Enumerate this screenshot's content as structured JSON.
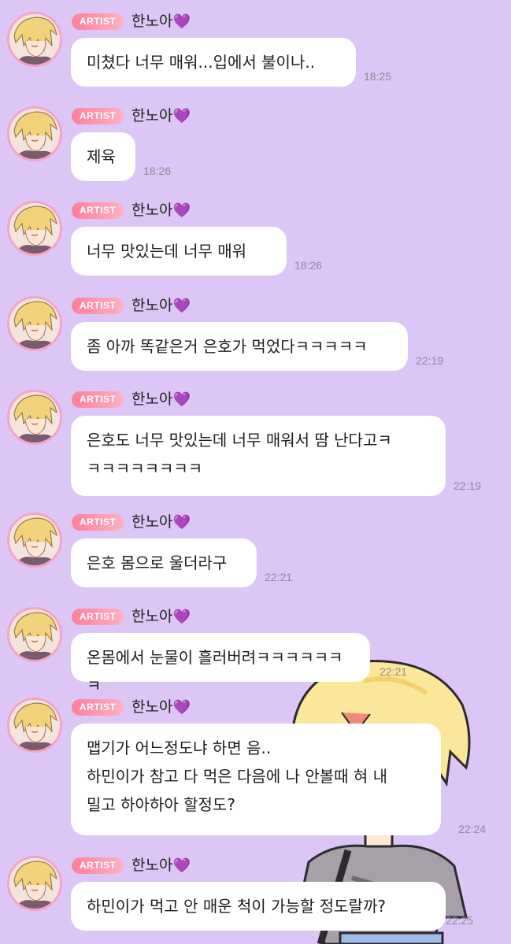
{
  "sender": {
    "badge": "ARTIST",
    "name": "한노아",
    "heart": "💜"
  },
  "messages": [
    {
      "text": "미쳤다 너무 매워...입에서 불이나..",
      "time": "18:25"
    },
    {
      "text": "제육",
      "time": "18:26"
    },
    {
      "text": "너무 맛있는데 너무 매워",
      "time": "18:26"
    },
    {
      "text": "좀 아까 똑같은거 은호가 먹었다ㅋㅋㅋㅋㅋ",
      "time": "22:19"
    },
    {
      "text": "은호도 너무 맛있는데 너무 매워서 땀 난다고ㅋ\nㅋㅋㅋㅋㅋㅋㅋㅋ",
      "time": "22:19"
    },
    {
      "text": "은호 몸으로 울더라구",
      "time": "22:21"
    },
    {
      "text": "온몸에서 눈물이 흘러버려ㅋㅋㅋㅋㅋㅋㅋ",
      "time": "22:21"
    },
    {
      "text": "맵기가 어느정도냐 하면 음..\n하민이가 참고 다 먹은 다음에 나 안볼때 혀 내\n밀고 하아하아 할정도?",
      "time": "22:24"
    },
    {
      "text": "하민이가 먹고 안 매운 척이 가능할 정도랄까?",
      "time": "22:25"
    }
  ],
  "colors": {
    "background": "#dcc6f5",
    "bubble": "#ffffff",
    "badge": "#ff7f9a",
    "avatar_ring": "#f5a3c7",
    "timestamp": "#8f8899"
  }
}
